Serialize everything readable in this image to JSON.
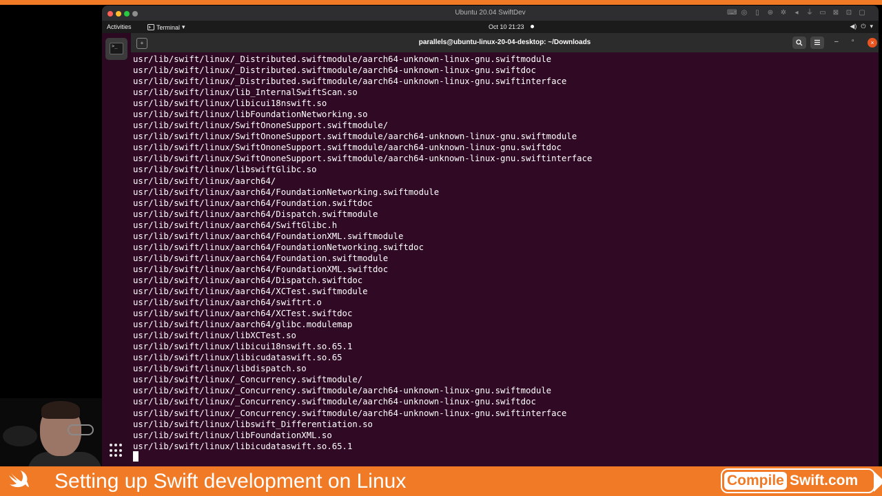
{
  "mac_window": {
    "title": "Ubuntu 20.04 SwiftDev",
    "traffic_colors": [
      "#fe5f57",
      "#febc2e",
      "#28c840",
      "#8e8e8e"
    ],
    "status_icons": [
      "keyboard-icon",
      "globe-icon",
      "lock-icon",
      "network-icon",
      "settings-icon",
      "sound-icon",
      "usb-icon",
      "folder-icon",
      "camera-icon",
      "share-icon",
      "window-icon"
    ]
  },
  "topbar": {
    "activities": "Activities",
    "app_menu": "Terminal",
    "clock": "Oct 10  21:23",
    "tray_icons": [
      "network-icon",
      "volume-icon",
      "power-icon"
    ]
  },
  "terminal": {
    "title": "parallels@ubuntu-linux-20-04-desktop: ~/Downloads",
    "background": "#300a24",
    "lines": [
      "usr/lib/swift/linux/_Distributed.swiftmodule/aarch64-unknown-linux-gnu.swiftmodule",
      "usr/lib/swift/linux/_Distributed.swiftmodule/aarch64-unknown-linux-gnu.swiftdoc",
      "usr/lib/swift/linux/_Distributed.swiftmodule/aarch64-unknown-linux-gnu.swiftinterface",
      "usr/lib/swift/linux/lib_InternalSwiftScan.so",
      "usr/lib/swift/linux/libicui18nswift.so",
      "usr/lib/swift/linux/libFoundationNetworking.so",
      "usr/lib/swift/linux/SwiftOnoneSupport.swiftmodule/",
      "usr/lib/swift/linux/SwiftOnoneSupport.swiftmodule/aarch64-unknown-linux-gnu.swiftmodule",
      "usr/lib/swift/linux/SwiftOnoneSupport.swiftmodule/aarch64-unknown-linux-gnu.swiftdoc",
      "usr/lib/swift/linux/SwiftOnoneSupport.swiftmodule/aarch64-unknown-linux-gnu.swiftinterface",
      "usr/lib/swift/linux/libswiftGlibc.so",
      "usr/lib/swift/linux/aarch64/",
      "usr/lib/swift/linux/aarch64/FoundationNetworking.swiftmodule",
      "usr/lib/swift/linux/aarch64/Foundation.swiftdoc",
      "usr/lib/swift/linux/aarch64/Dispatch.swiftmodule",
      "usr/lib/swift/linux/aarch64/SwiftGlibc.h",
      "usr/lib/swift/linux/aarch64/FoundationXML.swiftmodule",
      "usr/lib/swift/linux/aarch64/FoundationNetworking.swiftdoc",
      "usr/lib/swift/linux/aarch64/Foundation.swiftmodule",
      "usr/lib/swift/linux/aarch64/FoundationXML.swiftdoc",
      "usr/lib/swift/linux/aarch64/Dispatch.swiftdoc",
      "usr/lib/swift/linux/aarch64/XCTest.swiftmodule",
      "usr/lib/swift/linux/aarch64/swiftrt.o",
      "usr/lib/swift/linux/aarch64/XCTest.swiftdoc",
      "usr/lib/swift/linux/aarch64/glibc.modulemap",
      "usr/lib/swift/linux/libXCTest.so",
      "usr/lib/swift/linux/libicui18nswift.so.65.1",
      "usr/lib/swift/linux/libicudataswift.so.65",
      "usr/lib/swift/linux/libdispatch.so",
      "usr/lib/swift/linux/_Concurrency.swiftmodule/",
      "usr/lib/swift/linux/_Concurrency.swiftmodule/aarch64-unknown-linux-gnu.swiftmodule",
      "usr/lib/swift/linux/_Concurrency.swiftmodule/aarch64-unknown-linux-gnu.swiftdoc",
      "usr/lib/swift/linux/_Concurrency.swiftmodule/aarch64-unknown-linux-gnu.swiftinterface",
      "usr/lib/swift/linux/libswift_Differentiation.so",
      "usr/lib/swift/linux/libFoundationXML.so",
      "usr/lib/swift/linux/libicudataswift.so.65.1"
    ]
  },
  "banner": {
    "title": "Setting up Swift development on Linux",
    "brand_left": "Compile",
    "brand_right": "Swift.com",
    "color": "#f07a26"
  }
}
